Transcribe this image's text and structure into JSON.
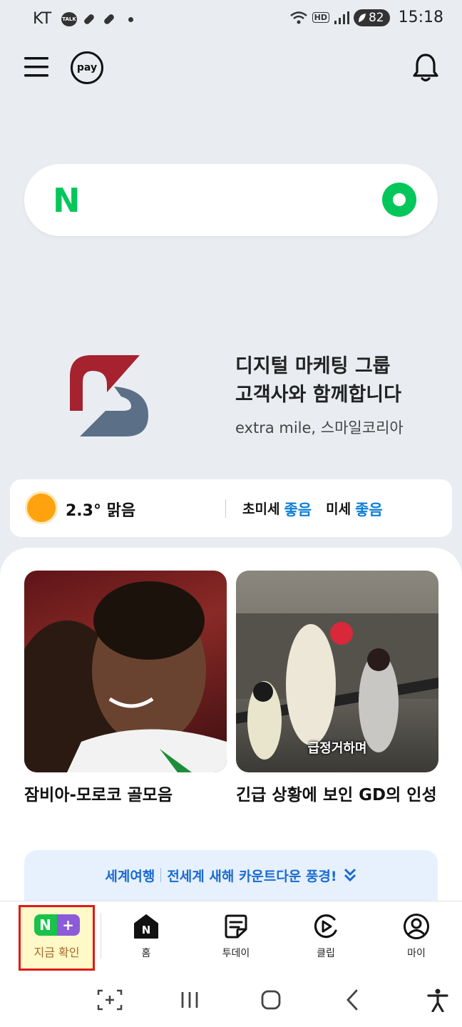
{
  "status_bar": {
    "carrier": "KT",
    "talk_icon_text": "TALK",
    "network_badge": "HD",
    "battery": "82",
    "time": "15:18"
  },
  "header": {
    "pay_label": "pay"
  },
  "search": {
    "logo_letter": "N"
  },
  "ad": {
    "line1": "디지털 마케팅 그룹",
    "line2": "고객사와 함께합니다",
    "line3": "extra mile, 스마일코리아"
  },
  "weather": {
    "temp_condition": "2.3° 맑음",
    "ultrafine_label": "초미세",
    "ultrafine_value": "좋음",
    "fine_label": "미세",
    "fine_value": "좋음"
  },
  "feed": {
    "cards": [
      {
        "title": "잠비아-모로코 골모음",
        "overlay": ""
      },
      {
        "title": "긴급 상황에 보인 GD의 인성",
        "overlay": "급정거하며"
      }
    ],
    "topic": {
      "tag": "세계여행",
      "text": "전세계 새해 카운트다운 풍경!"
    }
  },
  "bottom_nav": {
    "nplus_n": "N",
    "nplus_plus": "+",
    "nplus_label": "지금 확인",
    "home_icon_letter": "N",
    "home_label": "홈",
    "today_label": "투데이",
    "clip_label": "클립",
    "my_label": "마이"
  },
  "colors": {
    "naver_green": "#03c75a",
    "link_blue": "#0f7fd6",
    "highlight_red": "#e01919"
  }
}
